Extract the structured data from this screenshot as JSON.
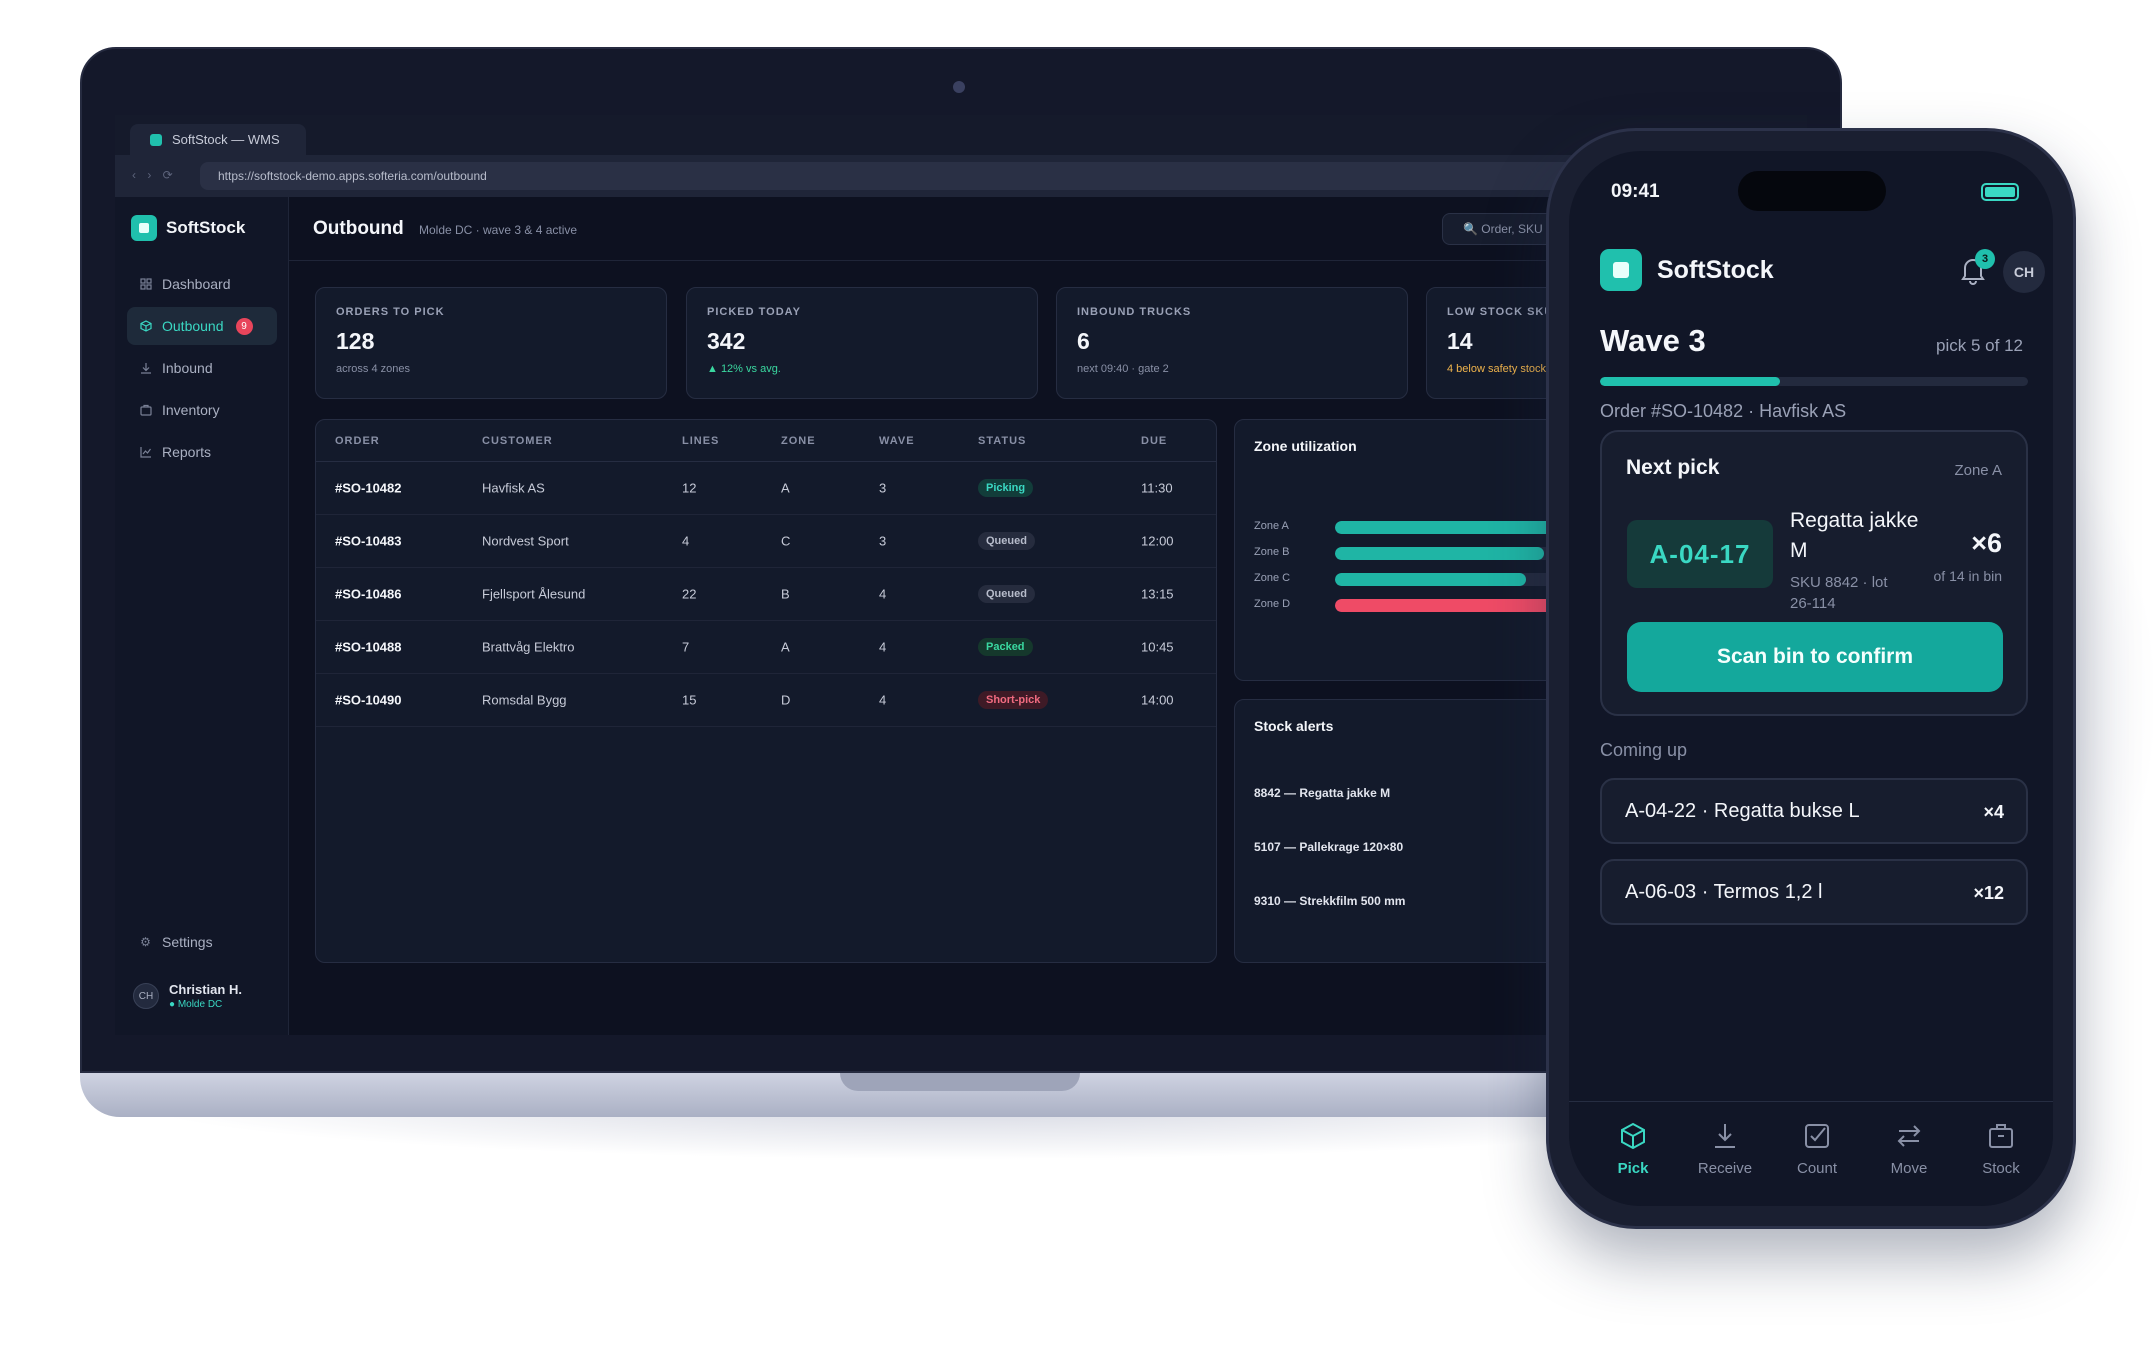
{
  "browser": {
    "tab_title": "SoftStock — WMS",
    "url": "https://softstock-demo.apps.softeria.com/outbound"
  },
  "brand": {
    "name": "SoftStock",
    "accent": "#20c0ad"
  },
  "sidebar": {
    "items": [
      {
        "label": "Dashboard",
        "icon": "grid-icon"
      },
      {
        "label": "Outbound",
        "icon": "box-icon",
        "badge": "9",
        "active": true
      },
      {
        "label": "Inbound",
        "icon": "download-icon"
      },
      {
        "label": "Inventory",
        "icon": "package-icon"
      },
      {
        "label": "Reports",
        "icon": "chart-line-icon"
      }
    ],
    "settings_label": "Settings",
    "user": {
      "initials": "CH",
      "name": "Christian H.",
      "location": "● Molde DC"
    }
  },
  "header": {
    "title": "Outbound",
    "subtitle": "Molde DC · wave 3 & 4 active",
    "search_placeholder": "🔍 Order, SKU"
  },
  "kpis": [
    {
      "label": "ORDERS TO PICK",
      "value": "128",
      "sub": "across 4 zones",
      "tone": "muted"
    },
    {
      "label": "PICKED TODAY",
      "value": "342",
      "sub": "▲ 12% vs avg.",
      "tone": "green"
    },
    {
      "label": "INBOUND TRUCKS",
      "value": "6",
      "sub": "next 09:40 · gate 2",
      "tone": "muted"
    },
    {
      "label": "LOW STOCK SKUS",
      "value": "14",
      "sub": "4 below safety stock",
      "tone": "amber"
    }
  ],
  "orders_table": {
    "columns": [
      "ORDER",
      "CUSTOMER",
      "LINES",
      "ZONE",
      "WAVE",
      "STATUS",
      "DUE"
    ],
    "rows": [
      {
        "order": "#SO-10482",
        "customer": "Havfisk AS",
        "lines": "12",
        "zone": "A",
        "wave": "3",
        "status": "Picking",
        "status_kind": "picking",
        "due": "11:30"
      },
      {
        "order": "#SO-10483",
        "customer": "Nordvest Sport",
        "lines": "4",
        "zone": "C",
        "wave": "3",
        "status": "Queued",
        "status_kind": "queued",
        "due": "12:00"
      },
      {
        "order": "#SO-10486",
        "customer": "Fjellsport Ålesund",
        "lines": "22",
        "zone": "B",
        "wave": "4",
        "status": "Queued",
        "status_kind": "queued",
        "due": "13:15"
      },
      {
        "order": "#SO-10488",
        "customer": "Brattvåg Elektro",
        "lines": "7",
        "zone": "A",
        "wave": "4",
        "status": "Packed",
        "status_kind": "packed",
        "due": "10:45"
      },
      {
        "order": "#SO-10490",
        "customer": "Romsdal Bygg",
        "lines": "15",
        "zone": "D",
        "wave": "4",
        "status": "Short-pick",
        "status_kind": "short",
        "due": "14:00"
      }
    ]
  },
  "zone_utilization": {
    "title": "Zone utilization",
    "zones": [
      {
        "label": "Zone A",
        "fraction": 0.78,
        "color": "#1fb5a5"
      },
      {
        "label": "Zone B",
        "fraction": 0.72,
        "color": "#1fb5a5"
      },
      {
        "label": "Zone C",
        "fraction": 0.66,
        "color": "#1fb5a5"
      },
      {
        "label": "Zone D",
        "fraction": 0.94,
        "color": "#ef4b66"
      }
    ]
  },
  "stock_alerts": {
    "title": "Stock alerts",
    "items": [
      "8842 — Regatta jakke M",
      "5107 — Pallekrage 120×80",
      "9310 — Strekkfilm 500 mm"
    ]
  },
  "phone": {
    "time": "09:41",
    "brand": "SoftStock",
    "notifications": "3",
    "avatar": "CH",
    "wave_title": "Wave 3",
    "wave_progress_label": "pick 5 of 12",
    "wave_progress_fraction": 0.42,
    "order_line": "Order #SO-10482 · Havfisk AS",
    "next_pick": {
      "title": "Next pick",
      "zone": "Zone A",
      "bin": "A-04-17",
      "item": "Regatta jakke M",
      "sku": "SKU 8842 · lot 26-114",
      "qty": "×6",
      "qty_sub": "of 14 in bin",
      "scan_label": "Scan bin to confirm"
    },
    "coming_up": {
      "label": "Coming up",
      "items": [
        {
          "label": "A-04-22 · Regatta bukse L",
          "qty": "×4"
        },
        {
          "label": "A-06-03 · Termos 1,2 l",
          "qty": "×12"
        }
      ]
    },
    "tabs": [
      {
        "label": "Pick",
        "icon": "cube-icon",
        "active": true
      },
      {
        "label": "Receive",
        "icon": "download-icon"
      },
      {
        "label": "Count",
        "icon": "checkbox-icon"
      },
      {
        "label": "Move",
        "icon": "arrows-swap-icon"
      },
      {
        "label": "Stock",
        "icon": "briefcase-icon"
      }
    ]
  }
}
